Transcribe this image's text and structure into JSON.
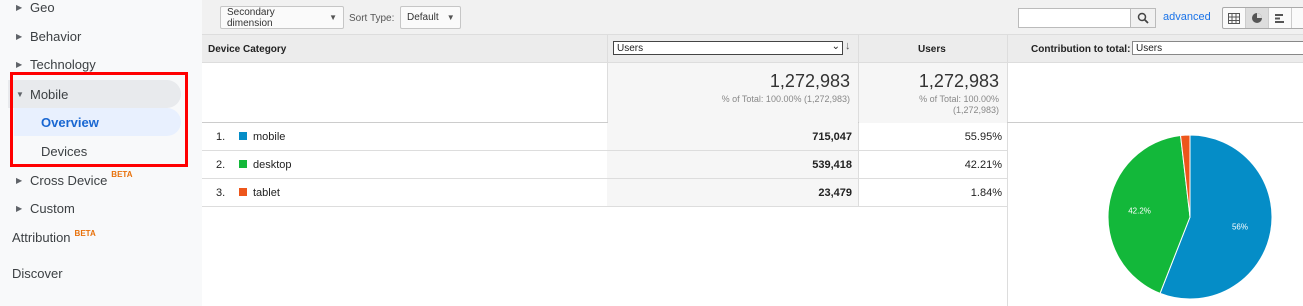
{
  "sidebar": {
    "items": [
      {
        "label": "Geo"
      },
      {
        "label": "Behavior"
      },
      {
        "label": "Technology"
      },
      {
        "label": "Mobile"
      },
      {
        "label": "Cross Device",
        "badge": "BETA"
      },
      {
        "label": "Custom"
      }
    ],
    "mobile_sub": [
      {
        "label": "Overview"
      },
      {
        "label": "Devices"
      }
    ],
    "top": [
      {
        "label": "Attribution",
        "badge": "BETA"
      },
      {
        "label": "Discover"
      }
    ]
  },
  "toolbar": {
    "secondary_dimension": "Secondary dimension",
    "sort_type_label": "Sort Type:",
    "sort_type_value": "Default",
    "search_value": "",
    "advanced": "advanced"
  },
  "table": {
    "headers": {
      "dimension": "Device Category",
      "metric_select": "Users",
      "metric": "Users",
      "contribution_label": "Contribution to total:",
      "contribution_select": "Users"
    },
    "totals": {
      "value": "1,272,983",
      "pct_line": "% of Total: 100.00% (1,272,983)",
      "pct_line_a": "% of Total: 100.00%",
      "pct_line_b": "(1,272,983)"
    },
    "rows": [
      {
        "index": "1.",
        "name": "mobile",
        "value": "715,047",
        "pct": "55.95%",
        "color": "#058dc7"
      },
      {
        "index": "2.",
        "name": "desktop",
        "value": "539,418",
        "pct": "42.21%",
        "color": "#13b83a"
      },
      {
        "index": "3.",
        "name": "tablet",
        "value": "23,479",
        "pct": "1.84%",
        "color": "#ed561b"
      }
    ]
  },
  "chart_data": {
    "type": "pie",
    "categories": [
      "mobile",
      "desktop",
      "tablet"
    ],
    "values": [
      55.95,
      42.21,
      1.84
    ],
    "colors": [
      "#058dc7",
      "#13b83a",
      "#ed561b"
    ],
    "labels": [
      "56%",
      "42.2%",
      ""
    ]
  }
}
